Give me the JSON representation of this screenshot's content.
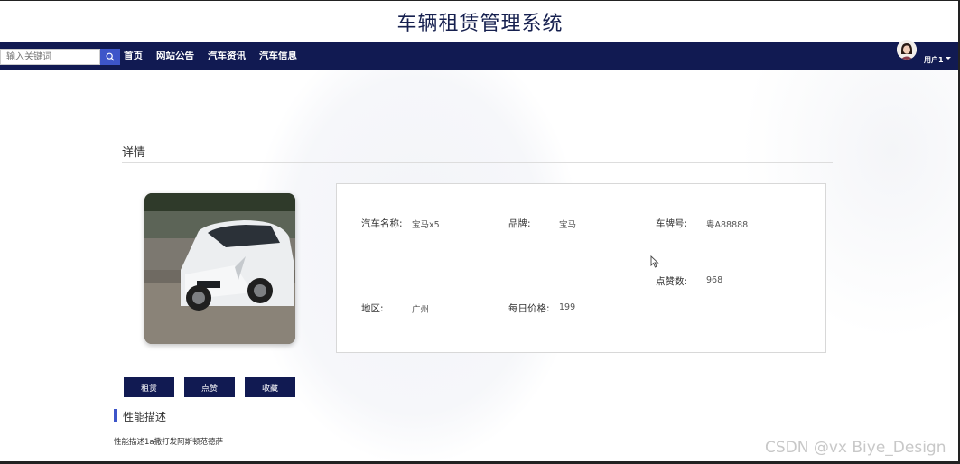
{
  "app": {
    "title": "车辆租赁管理系统"
  },
  "search": {
    "placeholder": "输入关键词"
  },
  "nav": {
    "items": [
      "首页",
      "网站公告",
      "汽车资讯",
      "汽车信息"
    ]
  },
  "user": {
    "name": "用户1"
  },
  "detail": {
    "section_title": "详情",
    "fields": {
      "car_name_label": "汽车名称:",
      "car_name_value": "宝马x5",
      "brand_label": "品牌:",
      "brand_value": "宝马",
      "plate_label": "车牌号:",
      "plate_value": "粤A88888",
      "likes_label": "点赞数:",
      "likes_value": "968",
      "region_label": "地区:",
      "region_value": "广州",
      "price_label": "每日价格:",
      "price_value": "199"
    },
    "buttons": {
      "rent": "租赁",
      "like": "点赞",
      "favorite": "收藏"
    }
  },
  "performance": {
    "title": "性能描述",
    "text": "性能描述1a撒打发阿斯顿范德萨"
  },
  "watermark": "CSDN @vx Biye_Design",
  "colors": {
    "navbar": "#111a52",
    "accent": "#3d55c9",
    "title": "#16204f"
  }
}
